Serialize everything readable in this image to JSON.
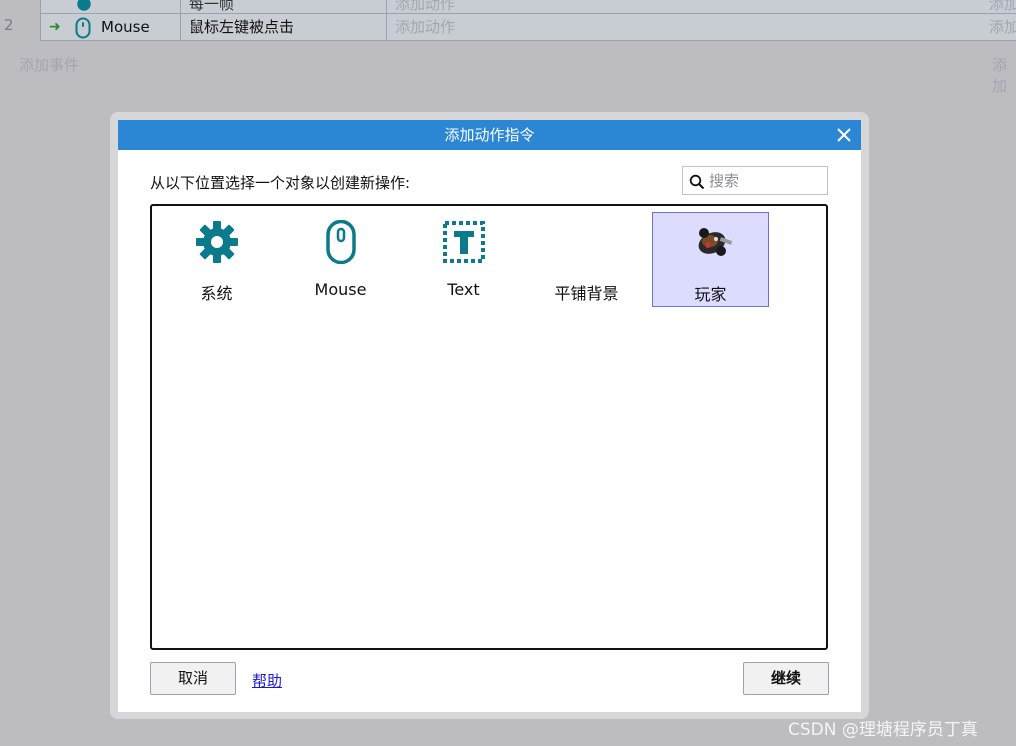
{
  "sheet": {
    "row2_number": "2",
    "row2_object": "Mouse",
    "row2_condition": "鼠标左键被点击",
    "row2_action": "添加动作",
    "row2_add": "添加",
    "add_event": "添加事件",
    "add_event_right": "添加",
    "row1_cond": "每一帧",
    "row1_action": "添加动作",
    "row1_add": "添加"
  },
  "dialog": {
    "title": "添加动作指令",
    "prompt": "从以下位置选择一个对象以创建新操作:",
    "search_placeholder": "搜索",
    "objects": [
      {
        "label": "系统",
        "icon": "gear-icon"
      },
      {
        "label": "Mouse",
        "icon": "mouse-icon"
      },
      {
        "label": "Text",
        "icon": "text-icon"
      },
      {
        "label": "平铺背景",
        "icon": "none"
      },
      {
        "label": "玩家",
        "icon": "player-sprite-icon",
        "selected": true
      }
    ],
    "cancel_label": "取消",
    "help_label": "帮助",
    "continue_label": "继续"
  },
  "colors": {
    "titlebar": "#2b86d4",
    "teal_icon": "#0b7a8a",
    "selection_bg": "#dcdcff",
    "selection_border": "#6f6fe0"
  },
  "watermark": "CSDN @理塘程序员丁真"
}
